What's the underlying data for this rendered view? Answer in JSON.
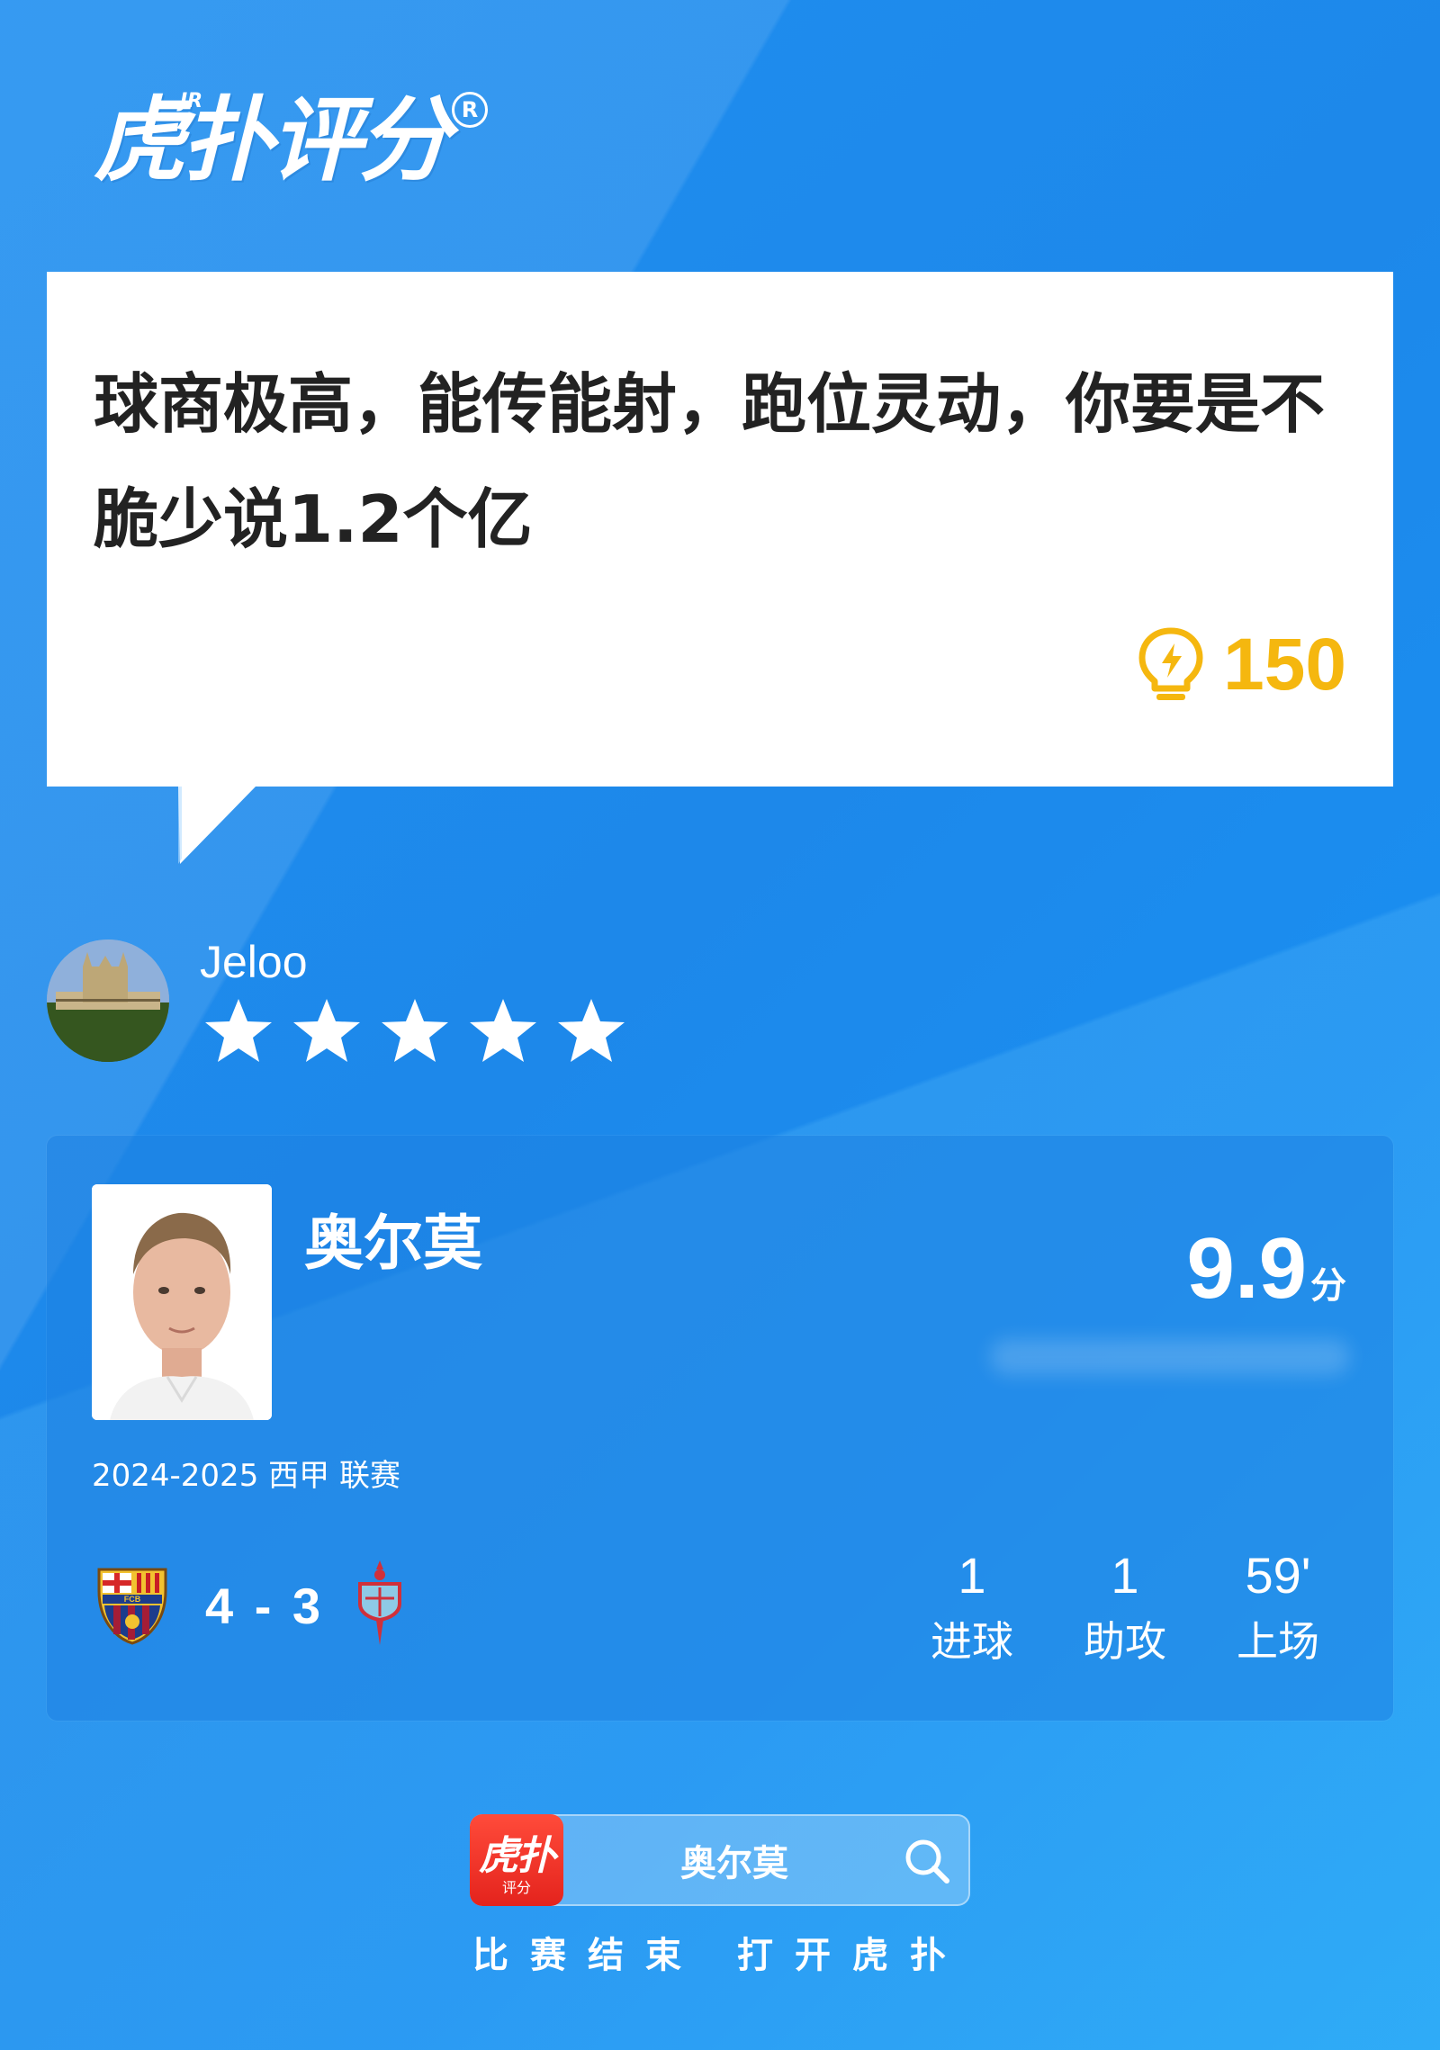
{
  "brand": {
    "logo_text": "虎扑评分",
    "logo_superscript": "JR",
    "registered_mark": "R"
  },
  "comment": {
    "text": "球商极高，能传能射，跑位灵动，你要是不脆少说1.2个亿",
    "likes": "150",
    "likes_icon": "lightbulb-icon"
  },
  "user": {
    "name": "Jeloo",
    "rating_stars": 5,
    "rating_max": 5
  },
  "player": {
    "name": "奥尔莫",
    "score": "9.9",
    "score_unit": "分",
    "season": "2024-2025 西甲 联赛"
  },
  "match": {
    "home_crest": "fc-barcelona-crest",
    "score": "4 - 3",
    "away_crest": "celta-vigo-crest"
  },
  "stats": [
    {
      "value": "1",
      "label": "进球"
    },
    {
      "value": "1",
      "label": "助攻"
    },
    {
      "value": "59'",
      "label": "上场"
    }
  ],
  "search": {
    "app_icon_text": "虎扑",
    "app_icon_sub": "评分",
    "query": "奥尔莫"
  },
  "footer": {
    "text": "比赛结束 打开虎扑"
  },
  "colors": {
    "background": "#1d88ea",
    "likes": "#f5b70f",
    "app_icon": "#e4231d"
  }
}
